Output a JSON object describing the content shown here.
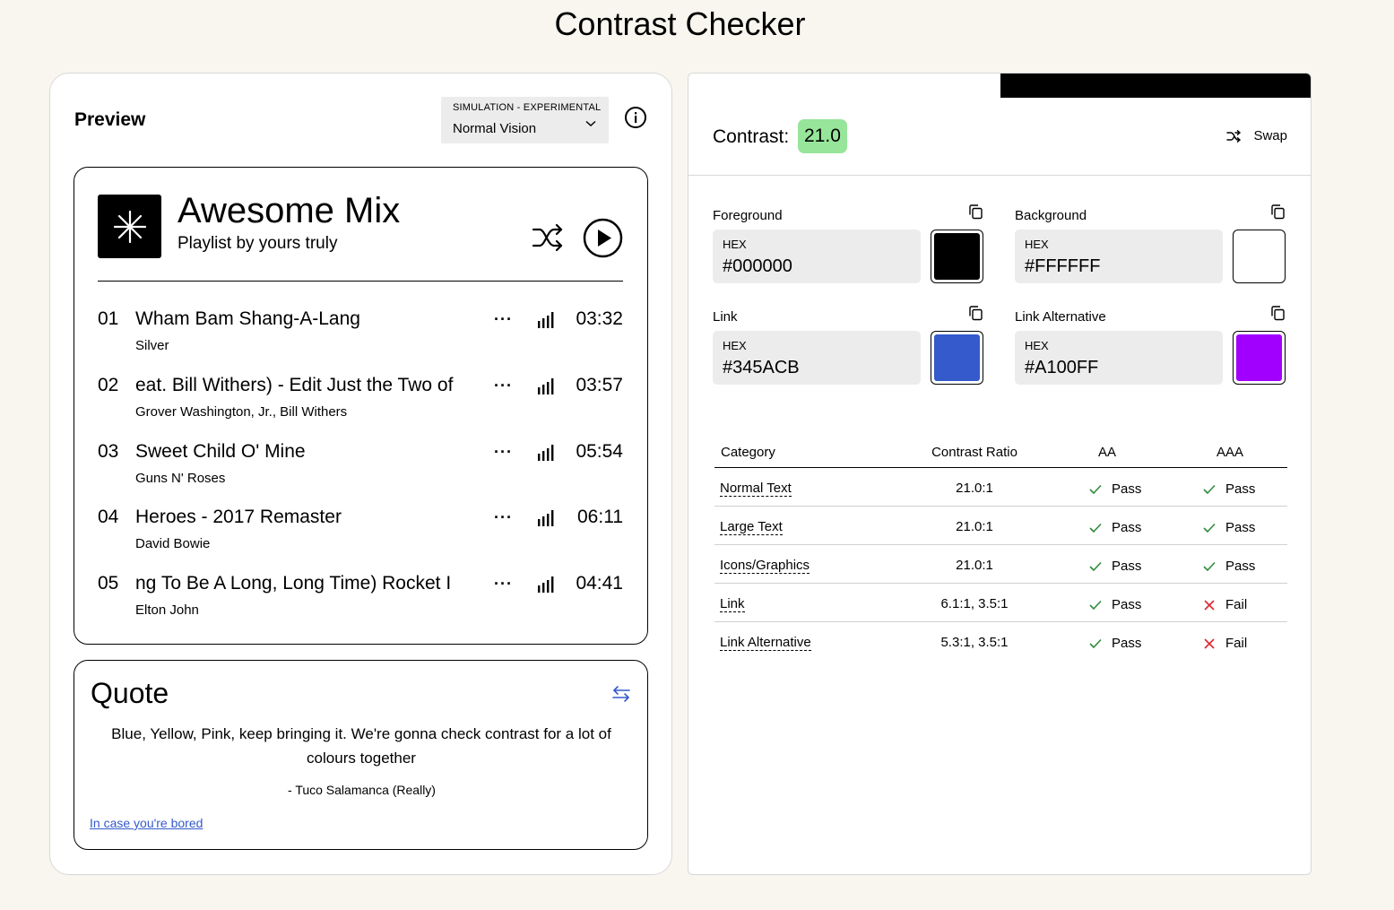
{
  "page_title": "Contrast Checker",
  "preview": {
    "title": "Preview",
    "simulation_label": "SIMULATION - EXPERIMENTAL",
    "simulation_value": "Normal Vision",
    "playlist": {
      "title": "Awesome Mix",
      "subtitle": "Playlist by yours truly",
      "tracks": [
        {
          "num": "01",
          "title": "Wham Bam Shang-A-Lang",
          "artist": "Silver",
          "duration": "03:32"
        },
        {
          "num": "02",
          "title": "eat. Bill Withers) - Edit   Just the Two of",
          "artist": "Grover Washington, Jr., Bill Withers",
          "duration": "03:57"
        },
        {
          "num": "03",
          "title": "Sweet Child O' Mine",
          "artist": "Guns N' Roses",
          "duration": "05:54"
        },
        {
          "num": "04",
          "title": "Heroes - 2017 Remaster",
          "artist": "David Bowie",
          "duration": "06:11"
        },
        {
          "num": "05",
          "title": "ng To Be A Long, Long Time)   Rocket I",
          "artist": "Elton John",
          "duration": "04:41"
        }
      ],
      "more_glyph": "···"
    },
    "quote": {
      "title": "Quote",
      "text": "Blue, Yellow, Pink, keep bringing it. We're gonna check contrast for a lot of colours together",
      "author": "- Tuco Salamanca (Really)",
      "link": "In case you're bored"
    }
  },
  "checker": {
    "contrast_label": "Contrast:",
    "contrast_value": "21.0",
    "swap_label": "Swap",
    "colors": [
      {
        "label": "Foreground",
        "hex_label": "HEX",
        "hex": "#000000",
        "swatch": "#000000"
      },
      {
        "label": "Background",
        "hex_label": "HEX",
        "hex": "#FFFFFF",
        "swatch": "#FFFFFF"
      },
      {
        "label": "Link",
        "hex_label": "HEX",
        "hex": "#345ACB",
        "swatch": "#345ACB"
      },
      {
        "label": "Link Alternative",
        "hex_label": "HEX",
        "hex": "#A100FF",
        "swatch": "#A100FF"
      }
    ],
    "table": {
      "headers": {
        "category": "Category",
        "ratio": "Contrast Ratio",
        "aa": "AA",
        "aaa": "AAA"
      },
      "rows": [
        {
          "category": "Normal Text",
          "ratio": "21.0:1",
          "aa": "Pass",
          "aaa": "Pass"
        },
        {
          "category": "Large Text",
          "ratio": "21.0:1",
          "aa": "Pass",
          "aaa": "Pass"
        },
        {
          "category": "Icons/Graphics",
          "ratio": "21.0:1",
          "aa": "Pass",
          "aaa": "Pass"
        },
        {
          "category": "Link",
          "ratio": "6.1:1, 3.5:1",
          "aa": "Pass",
          "aaa": "Fail"
        },
        {
          "category": "Link Alternative",
          "ratio": "5.3:1, 3.5:1",
          "aa": "Pass",
          "aaa": "Fail"
        }
      ]
    }
  },
  "colors": {
    "badge": "#97E59A",
    "pass": "#2e8b3a",
    "fail": "#e0252f",
    "link": "#345ACB"
  }
}
